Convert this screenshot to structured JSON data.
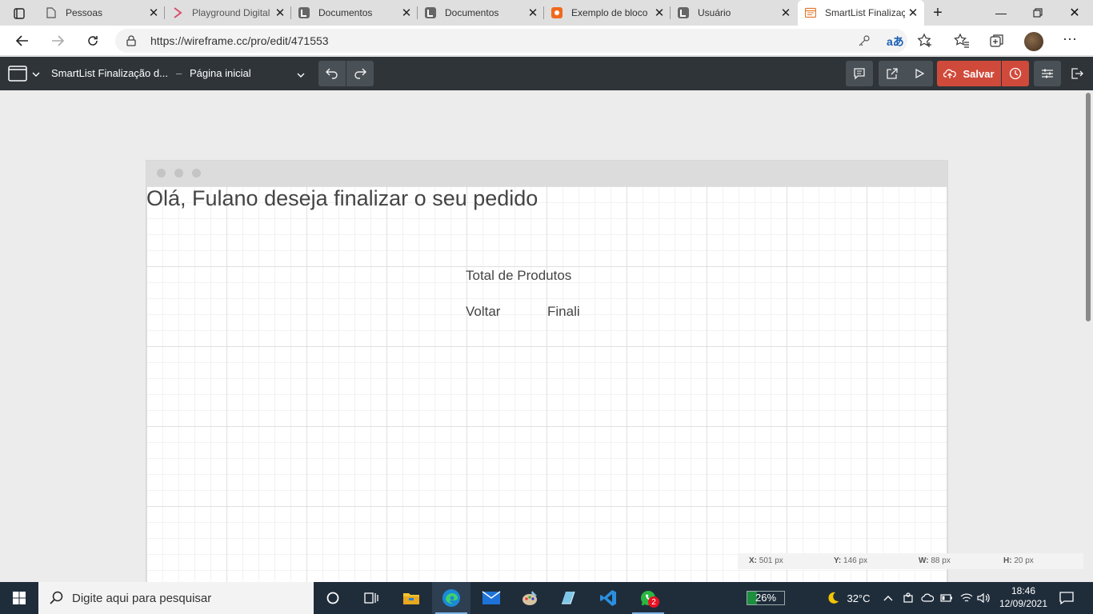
{
  "browser": {
    "tabs": [
      {
        "label": "Pessoas",
        "icon": "page-icon"
      },
      {
        "label": "Playground Digital",
        "icon": "playground-logo-icon"
      },
      {
        "label": "Documentos",
        "icon": "docs-app-icon"
      },
      {
        "label": "Documentos",
        "icon": "docs-app-icon"
      },
      {
        "label": "Exemplo de bloco",
        "icon": "orange-app-icon"
      },
      {
        "label": "Usuário",
        "icon": "docs-app-icon"
      },
      {
        "label": "SmartList Finalização",
        "icon": "wireframe-app-icon",
        "active": true
      }
    ],
    "url": "https://wireframe.cc/pro/edit/471553"
  },
  "app": {
    "project_title": "SmartList Finalização d...",
    "page_dash": "–",
    "page_name": "Página inicial",
    "save_label": "Salvar"
  },
  "wireframe": {
    "heading": "Olá, Fulano deseja finalizar o seu pedido",
    "total_label": "Total de Produtos",
    "back_label": "Voltar",
    "finish_label": "Finali"
  },
  "selection_info": {
    "x_label": "X:",
    "x_value": "501 px",
    "y_label": "Y:",
    "y_value": "146 px",
    "w_label": "W:",
    "w_value": "88 px",
    "h_label": "H:",
    "h_value": "20 px"
  },
  "taskbar": {
    "search_placeholder": "Digite aqui para pesquisar",
    "whatsapp_badge": "2",
    "battery": "26%",
    "temperature": "32°C",
    "time": "18:46",
    "date": "12/09/2021"
  },
  "colors": {
    "toolbar_bg": "#2e3438",
    "save_button": "#d04a3b",
    "taskbar_bg": "#1f2d3b"
  }
}
